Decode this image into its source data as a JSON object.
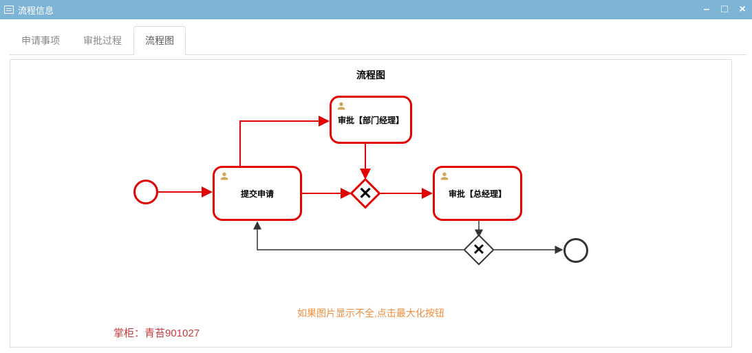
{
  "window": {
    "title": "流程信息"
  },
  "tabs": [
    {
      "id": "apply",
      "label": "申请事项",
      "active": false
    },
    {
      "id": "process",
      "label": "审批过程",
      "active": false
    },
    {
      "id": "chart",
      "label": "流程图",
      "active": true
    }
  ],
  "panel": {
    "title": "流程图"
  },
  "nodes": {
    "submit": {
      "label": "提交申请"
    },
    "dept": {
      "label": "审批【部门经理】"
    },
    "gm": {
      "label": "审批【总经理】"
    }
  },
  "hint": "如果图片显示不全,点击最大化按钮",
  "watermark": "掌柜：青苔901027",
  "chart_data": {
    "type": "flowchart",
    "title": "流程图",
    "highlight_color": "#e30000",
    "nodes": [
      {
        "id": "start",
        "type": "start-event",
        "label": "",
        "highlighted": true
      },
      {
        "id": "submit",
        "type": "user-task",
        "label": "提交申请",
        "highlighted": true
      },
      {
        "id": "dept",
        "type": "user-task",
        "label": "审批【部门经理】",
        "highlighted": true
      },
      {
        "id": "gw1",
        "type": "exclusive-gateway",
        "label": "",
        "highlighted": true
      },
      {
        "id": "gm",
        "type": "user-task",
        "label": "审批【总经理】",
        "highlighted": true
      },
      {
        "id": "gw2",
        "type": "exclusive-gateway",
        "label": "",
        "highlighted": false
      },
      {
        "id": "end",
        "type": "end-event",
        "label": "",
        "highlighted": false
      }
    ],
    "edges": [
      {
        "from": "start",
        "to": "submit",
        "highlighted": true
      },
      {
        "from": "submit",
        "to": "gw1",
        "highlighted": true
      },
      {
        "from": "submit",
        "to": "dept",
        "highlighted": true
      },
      {
        "from": "dept",
        "to": "gw1",
        "highlighted": true
      },
      {
        "from": "gw1",
        "to": "gm",
        "highlighted": true
      },
      {
        "from": "gm",
        "to": "gw2",
        "highlighted": false
      },
      {
        "from": "gw2",
        "to": "end",
        "highlighted": false
      },
      {
        "from": "gw2",
        "to": "submit",
        "highlighted": false
      }
    ]
  }
}
